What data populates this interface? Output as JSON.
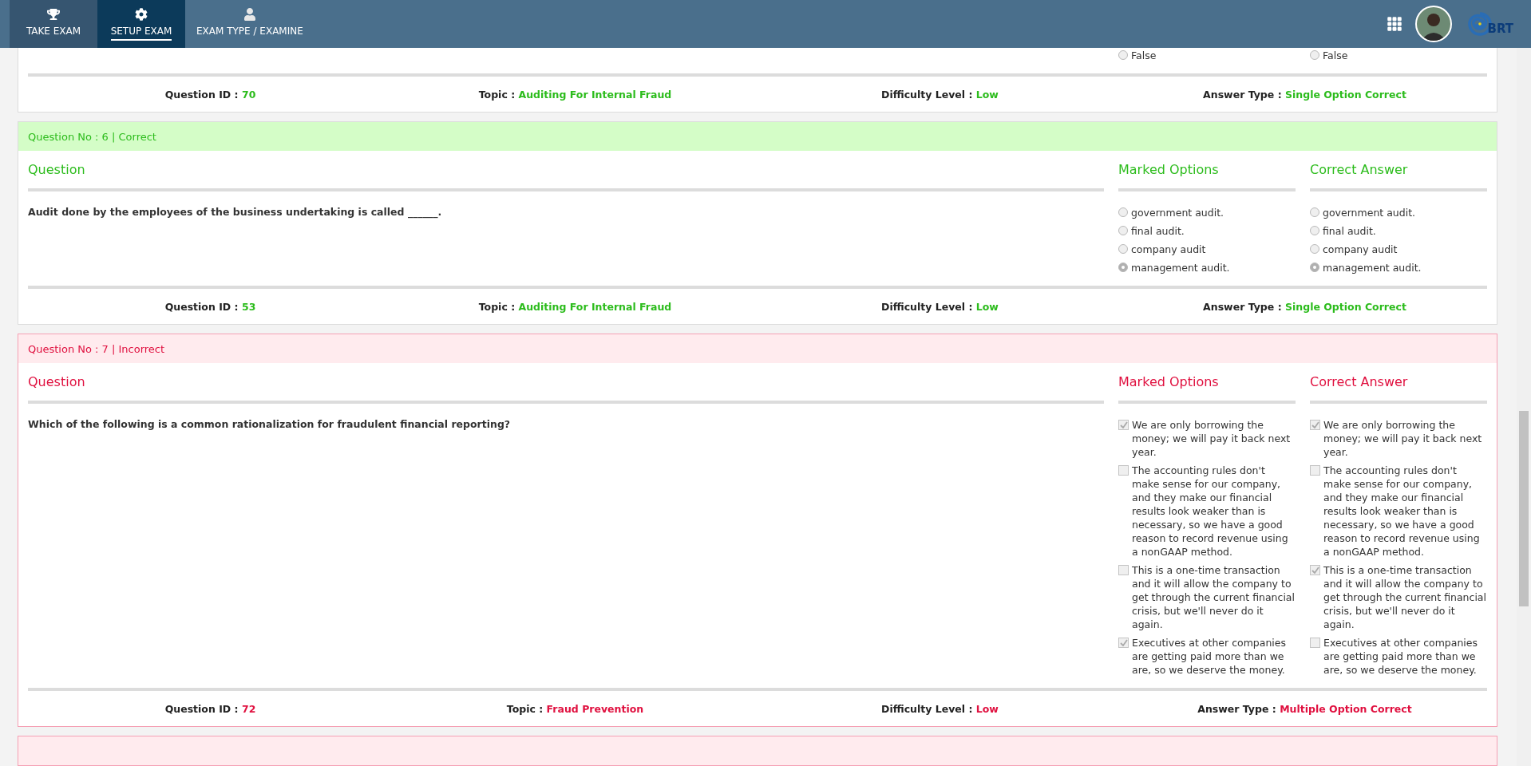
{
  "nav": {
    "tabs": [
      {
        "label": "TAKE EXAM",
        "kind": "trophy",
        "selected": false,
        "hovered": true
      },
      {
        "label": "SETUP EXAM",
        "kind": "gear",
        "selected": true,
        "hovered": false
      },
      {
        "label": "EXAM TYPE / EXAMINE",
        "kind": "user",
        "selected": false,
        "hovered": false
      }
    ],
    "logo_text": "BRT"
  },
  "cards": [
    {
      "kind": "correct",
      "marked_options": [
        {
          "kind": "radio",
          "label": "False",
          "checked": false
        }
      ],
      "correct_options": [
        {
          "kind": "radio",
          "label": "False",
          "checked": false
        }
      ],
      "footer": [
        {
          "label": "Question ID :",
          "value": "70"
        },
        {
          "label": "Topic :",
          "value": "Auditing For Internal Fraud"
        },
        {
          "label": "Difficulty Level :",
          "value": "Low"
        },
        {
          "label": "Answer Type :",
          "value": "Single Option Correct"
        }
      ]
    },
    {
      "kind": "correct",
      "title": "Question No : 6 | Correct",
      "question_heading": "Question",
      "marked_heading": "Marked Options",
      "correct_heading": "Correct Answer",
      "question": "Audit done by the employees of the business undertaking is called ______.",
      "marked_options": [
        {
          "kind": "radio",
          "label": "government audit.",
          "checked": false
        },
        {
          "kind": "radio",
          "label": "final audit.",
          "checked": false
        },
        {
          "kind": "radio",
          "label": "company audit",
          "checked": false
        },
        {
          "kind": "radio",
          "label": "management audit.",
          "checked": true
        }
      ],
      "correct_options": [
        {
          "kind": "radio",
          "label": "government audit.",
          "checked": false
        },
        {
          "kind": "radio",
          "label": "final audit.",
          "checked": false
        },
        {
          "kind": "radio",
          "label": "company audit",
          "checked": false
        },
        {
          "kind": "radio",
          "label": "management audit.",
          "checked": true
        }
      ],
      "footer": [
        {
          "label": "Question ID :",
          "value": "53"
        },
        {
          "label": "Topic :",
          "value": "Auditing For Internal Fraud"
        },
        {
          "label": "Difficulty Level :",
          "value": "Low"
        },
        {
          "label": "Answer Type :",
          "value": "Single Option Correct"
        }
      ]
    },
    {
      "kind": "incorrect",
      "title": "Question No : 7 | Incorrect",
      "question_heading": "Question",
      "marked_heading": "Marked Options",
      "correct_heading": "Correct Answer",
      "question": "Which of the following is a common rationalization for fraudulent financial reporting?",
      "marked_options": [
        {
          "kind": "checkbox",
          "label": "We are only borrowing the money; we will pay it back next year.",
          "checked": true
        },
        {
          "kind": "checkbox",
          "label": "The accounting rules don't make sense for our company, and they make our financial results look weaker than is necessary, so we have a good reason to record revenue using a nonGAAP method.",
          "checked": false
        },
        {
          "kind": "checkbox",
          "label": "This is a one-time transaction and it will allow the company to get through the current financial crisis, but we'll never do it again.",
          "checked": false
        },
        {
          "kind": "checkbox",
          "label": "Executives at other companies are getting paid more than we are, so we deserve the money.",
          "checked": true
        }
      ],
      "correct_options": [
        {
          "kind": "checkbox",
          "label": "We are only borrowing the money; we will pay it back next year.",
          "checked": true
        },
        {
          "kind": "checkbox",
          "label": "The accounting rules don't make sense for our company, and they make our financial results look weaker than is necessary, so we have a good reason to record revenue using a nonGAAP method.",
          "checked": false
        },
        {
          "kind": "checkbox",
          "label": "This is a one-time transaction and it will allow the company to get through the current financial crisis, but we'll never do it again.",
          "checked": true
        },
        {
          "kind": "checkbox",
          "label": "Executives at other companies are getting paid more than we are, so we deserve the money.",
          "checked": false
        }
      ],
      "footer": [
        {
          "label": "Question ID :",
          "value": "72"
        },
        {
          "label": "Topic :",
          "value": "Fraud Prevention"
        },
        {
          "label": "Difficulty Level :",
          "value": "Low"
        },
        {
          "label": "Answer Type :",
          "value": "Multiple Option Correct"
        }
      ]
    },
    {
      "kind": "incorrect"
    }
  ]
}
